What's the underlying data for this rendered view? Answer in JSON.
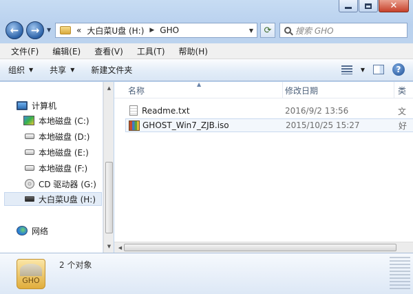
{
  "window": {
    "close_glyph": "✕"
  },
  "nav": {
    "back_glyph": "←",
    "forward_glyph": "→",
    "dropdown_glyph": "▼",
    "breadcrumb_root": "«",
    "breadcrumb": [
      "大白菜U盘 (H:)",
      "GHO"
    ],
    "breadcrumb_sep": "▶",
    "refresh_glyph": "⟳",
    "search_placeholder": "搜索 GHO"
  },
  "menu": [
    "文件(F)",
    "编辑(E)",
    "查看(V)",
    "工具(T)",
    "帮助(H)"
  ],
  "toolbar": {
    "organize": "组织",
    "share": "共享",
    "new_folder": "新建文件夹",
    "arrow": "▼",
    "help": "?"
  },
  "tree": {
    "computer": "计算机",
    "drives": [
      {
        "label": "本地磁盘 (C:)",
        "icon": "system-drive-icon"
      },
      {
        "label": "本地磁盘 (D:)",
        "icon": "drive-icon"
      },
      {
        "label": "本地磁盘 (E:)",
        "icon": "drive-icon"
      },
      {
        "label": "本地磁盘 (F:)",
        "icon": "drive-icon"
      },
      {
        "label": "CD 驱动器 (G:)",
        "icon": "cd-drive-icon"
      },
      {
        "label": "大白菜U盘 (H:)",
        "icon": "usb-drive-icon"
      }
    ],
    "network": "网络"
  },
  "columns": {
    "name": "名称",
    "date": "修改日期",
    "type": "类"
  },
  "files": [
    {
      "name": "Readme.txt",
      "date": "2016/9/2 13:56",
      "type": "文",
      "icon": "text-file-icon"
    },
    {
      "name": "GHOST_Win7_ZJB.iso",
      "date": "2015/10/25 15:27",
      "type": "好",
      "icon": "iso-file-icon"
    }
  ],
  "status": {
    "folder_icon_label": "GHO",
    "count": "2 个对象"
  },
  "colors": {
    "accent": "#2d63a8",
    "selection": "#e3ecf7"
  }
}
